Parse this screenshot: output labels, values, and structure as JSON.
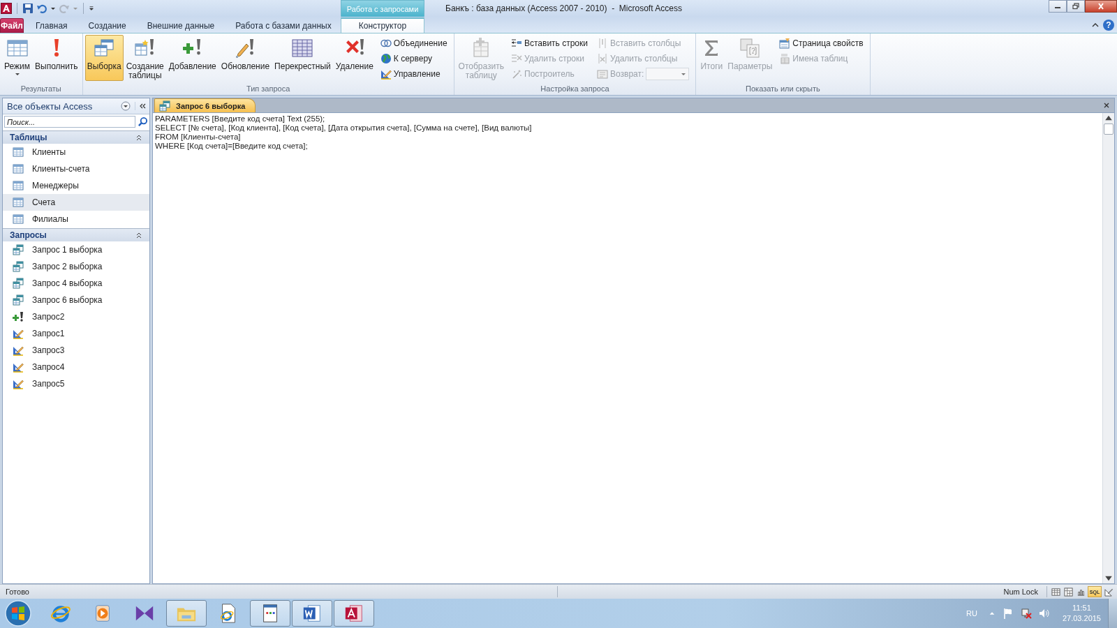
{
  "window": {
    "title": "Банкъ : база данных (Access 2007 - 2010)  -  Microsoft Access",
    "context_group": "Работа с запросами",
    "help": "?"
  },
  "tabs": [
    {
      "label": "Файл",
      "kind": "file",
      "selected": false
    },
    {
      "label": "Главная",
      "kind": "tab",
      "selected": false
    },
    {
      "label": "Создание",
      "kind": "tab",
      "selected": false
    },
    {
      "label": "Внешние данные",
      "kind": "tab",
      "selected": false
    },
    {
      "label": "Работа с базами данных",
      "kind": "tab",
      "selected": false
    },
    {
      "label": "Конструктор",
      "kind": "context",
      "selected": true
    }
  ],
  "ribbon": [
    {
      "title": "Результаты",
      "items": [
        {
          "kind": "large",
          "label": "Режим",
          "dropdown": true,
          "disabled": false,
          "selected": false
        },
        {
          "kind": "large",
          "label": "Выполнить",
          "dropdown": false,
          "disabled": false,
          "selected": false
        }
      ]
    },
    {
      "title": "Тип запроса",
      "items": [
        {
          "kind": "large",
          "label": "Выборка",
          "dropdown": false,
          "disabled": false,
          "selected": true
        },
        {
          "kind": "large",
          "label": "Создание таблицы",
          "dropdown": false,
          "disabled": false,
          "selected": false
        },
        {
          "kind": "large",
          "label": "Добавление",
          "dropdown": false,
          "disabled": false,
          "selected": false
        },
        {
          "kind": "large",
          "label": "Обновление",
          "dropdown": false,
          "disabled": false,
          "selected": false
        },
        {
          "kind": "large",
          "label": "Перекрестный",
          "dropdown": false,
          "disabled": false,
          "selected": false
        },
        {
          "kind": "large",
          "label": "Удаление",
          "dropdown": false,
          "disabled": false,
          "selected": false
        },
        {
          "kind": "stack",
          "buttons": [
            {
              "kind": "small",
              "label": "Объединение",
              "disabled": false
            },
            {
              "kind": "small",
              "label": "К серверу",
              "disabled": false
            },
            {
              "kind": "small",
              "label": "Управление",
              "disabled": false
            }
          ]
        }
      ]
    },
    {
      "title": "Настройка запроса",
      "items": [
        {
          "kind": "large",
          "label": "Отобразить таблицу",
          "dropdown": false,
          "disabled": true,
          "selected": false
        },
        {
          "kind": "stack",
          "buttons": [
            {
              "kind": "small",
              "label": "Вставить строки",
              "disabled": false
            },
            {
              "kind": "small",
              "label": "Удалить строки",
              "disabled": true
            },
            {
              "kind": "small",
              "label": "Построитель",
              "disabled": true
            }
          ]
        },
        {
          "kind": "stack",
          "buttons": [
            {
              "kind": "small",
              "label": "Вставить столбцы",
              "disabled": true
            },
            {
              "kind": "small",
              "label": "Удалить столбцы",
              "disabled": true
            },
            {
              "kind": "combo",
              "label": "Возврат:",
              "disabled": true
            }
          ]
        }
      ]
    },
    {
      "title": "Показать или скрыть",
      "items": [
        {
          "kind": "large",
          "label": "Итоги",
          "dropdown": false,
          "disabled": true,
          "selected": false
        },
        {
          "kind": "large",
          "label": "Параметры",
          "dropdown": false,
          "disabled": true,
          "selected": false
        },
        {
          "kind": "stack",
          "buttons": [
            {
              "kind": "small",
              "label": "Страница свойств",
              "disabled": false
            },
            {
              "kind": "small",
              "label": "Имена таблиц",
              "disabled": true
            }
          ]
        }
      ]
    }
  ],
  "navigation": {
    "title": "Все объекты Access",
    "search_placeholder": "Поиск...",
    "groups": [
      {
        "title": "Таблицы",
        "expanded": true,
        "items": [
          {
            "label": "Клиенты",
            "kind": "table",
            "selected": false
          },
          {
            "label": "Клиенты-счета",
            "kind": "table",
            "selected": false
          },
          {
            "label": "Менеджеры",
            "kind": "table",
            "selected": false
          },
          {
            "label": "Счета",
            "kind": "table",
            "selected": true
          },
          {
            "label": "Филиалы",
            "kind": "table",
            "selected": false
          }
        ]
      },
      {
        "title": "Запросы",
        "expanded": true,
        "items": [
          {
            "label": "Запрос 1 выборка",
            "kind": "select",
            "selected": false
          },
          {
            "label": "Запрос 2 выборка",
            "kind": "select",
            "selected": false
          },
          {
            "label": "Запрос 4 выборка",
            "kind": "select",
            "selected": false
          },
          {
            "label": "Запрос 6 выборка",
            "kind": "select",
            "selected": false
          },
          {
            "label": "Запрос2",
            "kind": "append",
            "selected": false
          },
          {
            "label": "Запрос1",
            "kind": "ddl",
            "selected": false
          },
          {
            "label": "Запрос3",
            "kind": "ddl",
            "selected": false
          },
          {
            "label": "Запрос4",
            "kind": "ddl",
            "selected": false
          },
          {
            "label": "Запрос5",
            "kind": "ddl",
            "selected": false
          }
        ]
      }
    ]
  },
  "document": {
    "tab": "Запрос 6 выборка",
    "sql_lines": [
      "PARAMETERS [Введите код счета] Text (255);",
      "SELECT [№ счета], [Код клиента], [Код счета], [Дата открытия счета], [Сумма на счете], [Вид валюты]",
      "FROM [Клиенты-счета]",
      "WHERE [Код счета]=[Введите код счета];"
    ]
  },
  "status_bar": {
    "text": "Готово",
    "indicator": "Num Lock",
    "views": [
      {
        "kind": "datasheet",
        "selected": false
      },
      {
        "kind": "pivot_table",
        "selected": false
      },
      {
        "kind": "pivot_chart",
        "selected": false
      },
      {
        "kind": "sql",
        "label": "SQL",
        "selected": true
      },
      {
        "kind": "design",
        "selected": false
      }
    ]
  },
  "taskbar": {
    "apps": [
      {
        "kind": "ie",
        "open": false
      },
      {
        "kind": "media",
        "open": false
      },
      {
        "kind": "vs",
        "open": false
      },
      {
        "kind": "explorer",
        "open": true
      },
      {
        "kind": "ie_doc",
        "open": false
      },
      {
        "kind": "viewer",
        "open": true
      },
      {
        "kind": "word",
        "open": true
      },
      {
        "kind": "access",
        "open": true
      }
    ],
    "language": "RU",
    "time": "11:51",
    "date": "27.03.2015"
  }
}
